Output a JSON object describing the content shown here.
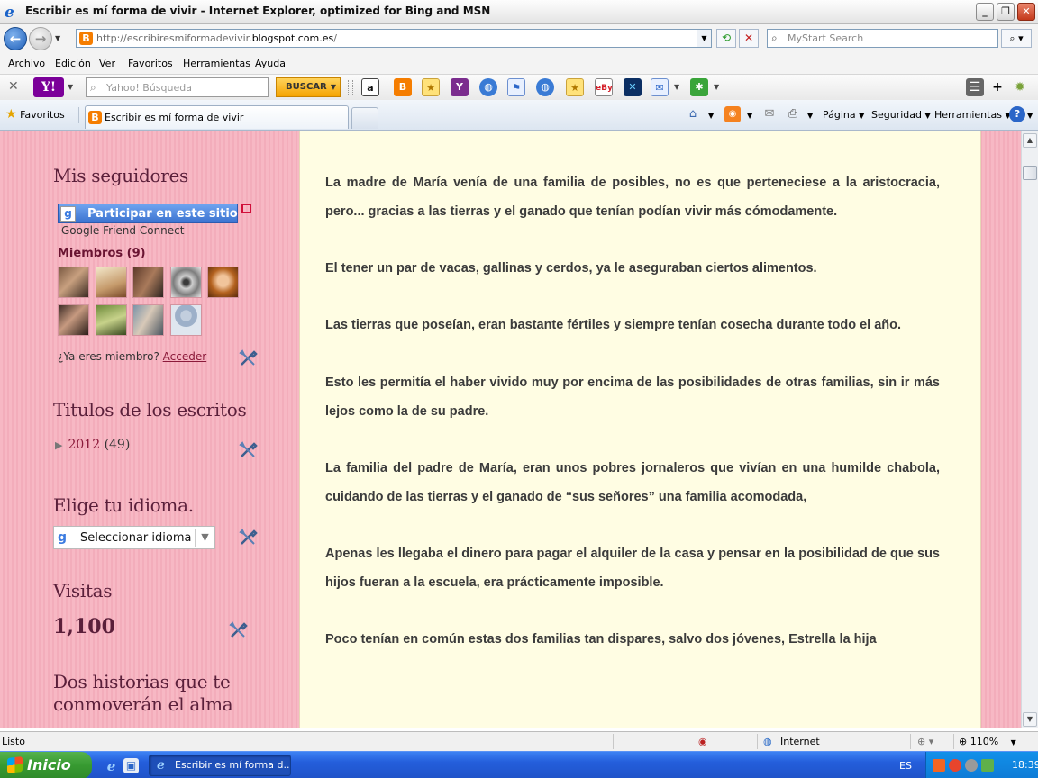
{
  "window": {
    "title": "Escribir es mí forma de vivir - Internet Explorer, optimized for Bing and MSN",
    "min": "_",
    "max": "❐",
    "close": "✕"
  },
  "address": {
    "url_prefix": "http://escribiresmiformadevivir.",
    "url_domain": "blogspot.com.es",
    "url_suffix": "/",
    "search_placeholder": "MyStart Search"
  },
  "menu": [
    "Archivo",
    "Edición",
    "Ver",
    "Favoritos",
    "Herramientas",
    "Ayuda"
  ],
  "yahoo_toolbar": {
    "search_placeholder": "Yahoo! Búsqueda",
    "search_button": "BUSCAR"
  },
  "tabs": {
    "favorites_label": "Favoritos",
    "active_tab": "Escribir es mí forma de vivir",
    "commands": [
      "Página",
      "Seguridad",
      "Herramientas"
    ]
  },
  "sidebar": {
    "followers_title": "Mis seguidores",
    "gfc_button": "Participar en este sitio",
    "gfc_sub": "Google Friend Connect",
    "members_title": "Miembros (9)",
    "member_question": "¿Ya eres miembro?",
    "member_link": "Acceder",
    "archive_title": "Titulos de los escritos",
    "archive_year": "2012",
    "archive_count": "(49)",
    "language_title": "Elige tu idioma.",
    "language_select": "Seleccionar idioma",
    "visits_title": "Visitas",
    "visits_count": "1,100",
    "stories_title_1": "Dos historias que te",
    "stories_title_2": "conmoverán el alma"
  },
  "post": {
    "paragraphs": [
      "La madre de María venía de una familia de posibles, no es que perteneciese a la aristocracia, pero... gracias a las tierras y el ganado que tenían podían vivir más cómodamente.",
      "El tener un par de vacas, gallinas y cerdos, ya le aseguraban ciertos alimentos.",
      "Las tierras que poseían, eran bastante fértiles y siempre tenían cosecha durante todo el año.",
      "Esto les permitía el haber vivido muy por encima de las posibilidades de otras familias, sin ir más lejos como la de su padre.",
      "La familia del padre de María, eran unos pobres jornaleros que vivían en una humilde chabola, cuidando de las tierras y el ganado de “sus señores” una familia acomodada,",
      "Apenas les llegaba el dinero para pagar el alquiler de la casa y pensar en la posibilidad de que sus hijos fueran a la escuela, era prácticamente imposible.",
      "Poco tenían en común estas dos familias tan dispares, salvo dos jóvenes, Estrella la hija"
    ]
  },
  "status": {
    "text": "Listo",
    "zone": "Internet",
    "zoom": "110%"
  },
  "taskbar": {
    "start": "Inicio",
    "task_item": "Escribir es mí forma d...",
    "language": "ES",
    "clock": "18:39"
  },
  "colors": {
    "sidebar_bg": "#f6b6c3",
    "post_bg": "#fffde3",
    "heading": "#5a1f3a",
    "post_text": "#3b3b3b"
  }
}
